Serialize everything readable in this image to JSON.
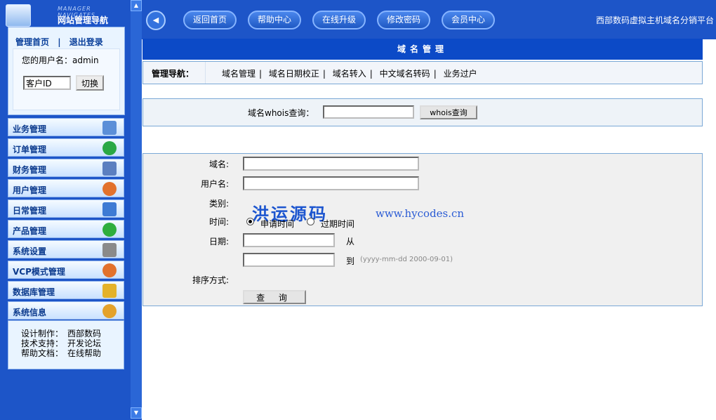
{
  "sidebar": {
    "logo_eng": "MANAGER NAVIGATES",
    "logo_cn": "网站管理导航",
    "home_link": "管理首页",
    "divider": "|",
    "logout_link": "退出登录",
    "username_label": "您的用户名：admin",
    "client_id_value": "客户ID",
    "switch_button": "切换",
    "menu": [
      {
        "label": "业务管理",
        "icon": "edit-document-icon",
        "color": "#5b8fd8"
      },
      {
        "label": "订单管理",
        "icon": "refresh-green-icon",
        "color": "#2aa845"
      },
      {
        "label": "财务管理",
        "icon": "presentation-icon",
        "color": "#5b7fc0"
      },
      {
        "label": "用户管理",
        "icon": "recycle-orange-icon",
        "color": "#e2722c"
      },
      {
        "label": "日常管理",
        "icon": "pen-edit-icon",
        "color": "#3e7bd4"
      },
      {
        "label": "产品管理",
        "icon": "play-green-icon",
        "color": "#2fae3d"
      },
      {
        "label": "系统设置",
        "icon": "tools-icon",
        "color": "#8a8a8a"
      },
      {
        "label": "VCP模式管理",
        "icon": "recycle-orange-icon",
        "color": "#e2722c"
      },
      {
        "label": "数据库管理",
        "icon": "lock-icon",
        "color": "#e4b22a"
      },
      {
        "label": "系统信息",
        "icon": "gears-icon",
        "color": "#e4a22a"
      }
    ],
    "credits": [
      {
        "k": "设计制作：",
        "v": "西部数码"
      },
      {
        "k": "技术支持：",
        "v": "开发论坛"
      },
      {
        "k": "帮助文档：",
        "v": "在线帮助"
      }
    ]
  },
  "topbar": {
    "buttons": [
      "返回首页",
      "帮助中心",
      "在线升级",
      "修改密码",
      "会员中心"
    ],
    "right_text": "西部数码虚拟主机域名分销平台"
  },
  "page": {
    "title": "域名管理",
    "nav_heading": "管理导航：",
    "nav_links": [
      "域名管理",
      "域名日期校正",
      "域名转入",
      "中文域名转码",
      "业务过户"
    ],
    "whois_label": "域名whois查询：",
    "whois_button": "whois查询",
    "form": {
      "domain_label": "域名:",
      "user_label": "用户名:",
      "category_label": "类别:",
      "time_label": "时间:",
      "radio_apply": "申请时间",
      "radio_expire": "过期时间",
      "date_label": "日期:",
      "from_text": "从",
      "to_text": "到",
      "date_hint": "(yyyy-mm-dd 2000-09-01)",
      "sort_label": "排序方式:",
      "submit": "查 询"
    },
    "watermark": "洪运源码",
    "watermark_url": "www.hycodes.cn"
  }
}
